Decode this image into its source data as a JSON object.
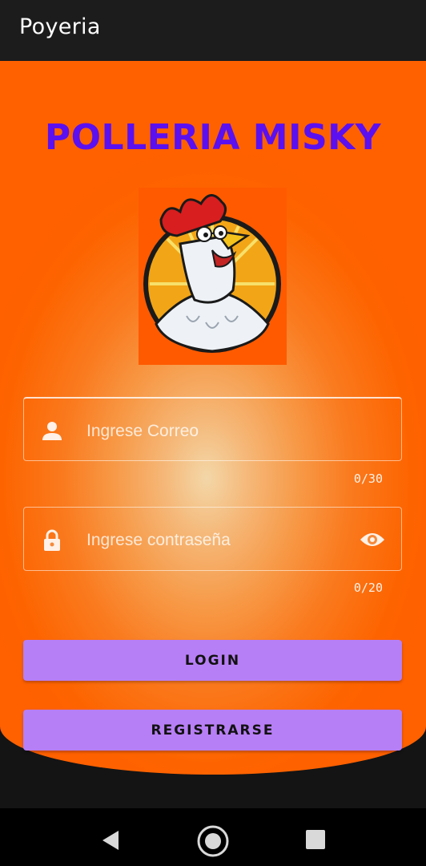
{
  "app_bar": {
    "title": "Poyeria"
  },
  "brand": {
    "title": "POLLERIA MISKY",
    "color": "#5b10f0"
  },
  "logo": {
    "icon": "rooster-mascot-icon"
  },
  "email_field": {
    "placeholder": "Ingrese Correo",
    "value": "",
    "counter": "0/30",
    "icon": "person-icon"
  },
  "password_field": {
    "placeholder": "Ingrese contraseña",
    "value": "",
    "counter": "0/20",
    "icon": "lock-icon",
    "toggle_icon": "eye-icon"
  },
  "buttons": {
    "login_label": "LOGIN",
    "register_label": "REGISTRARSE",
    "color": "#b77ff5"
  },
  "navigation": {
    "back_icon": "back-triangle-icon",
    "home_icon": "home-circle-icon",
    "recents_icon": "recents-square-icon"
  },
  "colors": {
    "accent_orange": "#ff6000",
    "app_bar": "#1c1c1c"
  }
}
